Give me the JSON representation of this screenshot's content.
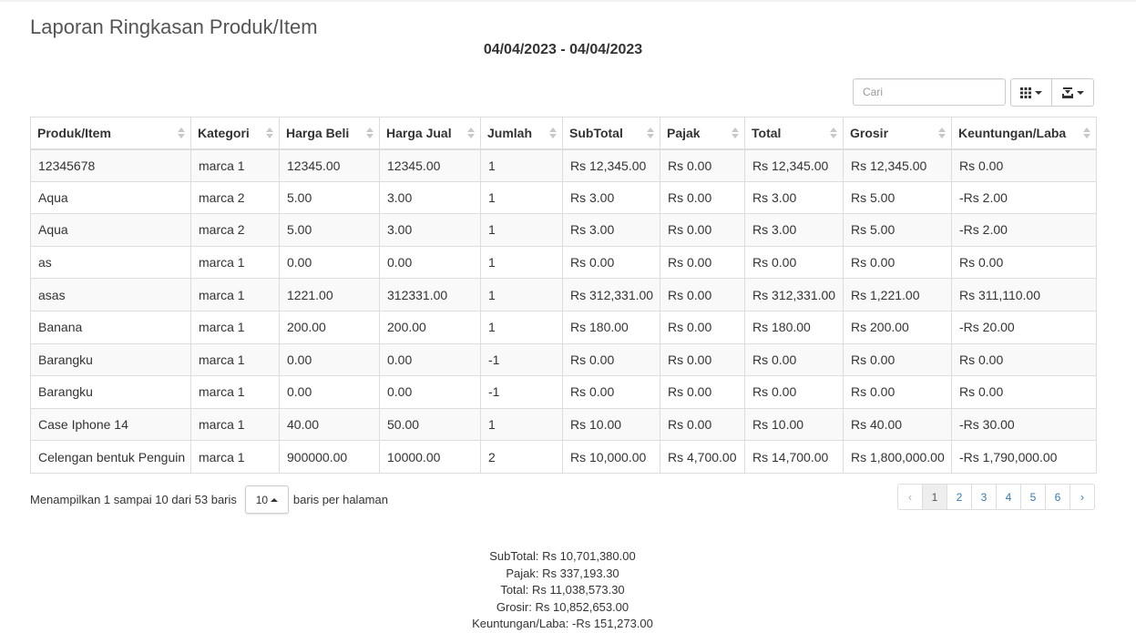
{
  "page": {
    "title": "Laporan Ringkasan Produk/Item",
    "date_range": "04/04/2023 - 04/04/2023"
  },
  "toolbar": {
    "search_placeholder": "Cari",
    "columns_icon": "grid-icon",
    "export_icon": "export-icon"
  },
  "table": {
    "headers": [
      "Produk/Item",
      "Kategori",
      "Harga Beli",
      "Harga Jual",
      "Jumlah",
      "SubTotal",
      "Pajak",
      "Total",
      "Grosir",
      "Keuntungan/Laba"
    ],
    "rows": [
      [
        "12345678",
        "marca 1",
        "12345.00",
        "12345.00",
        "1",
        "Rs 12,345.00",
        "Rs 0.00",
        "Rs 12,345.00",
        "Rs 12,345.00",
        "Rs 0.00"
      ],
      [
        "Aqua",
        "marca 2",
        "5.00",
        "3.00",
        "1",
        "Rs 3.00",
        "Rs 0.00",
        "Rs 3.00",
        "Rs 5.00",
        "-Rs 2.00"
      ],
      [
        "Aqua",
        "marca 2",
        "5.00",
        "3.00",
        "1",
        "Rs 3.00",
        "Rs 0.00",
        "Rs 3.00",
        "Rs 5.00",
        "-Rs 2.00"
      ],
      [
        "as",
        "marca 1",
        "0.00",
        "0.00",
        "1",
        "Rs 0.00",
        "Rs 0.00",
        "Rs 0.00",
        "Rs 0.00",
        "Rs 0.00"
      ],
      [
        "asas",
        "marca 1",
        "1221.00",
        "312331.00",
        "1",
        "Rs 312,331.00",
        "Rs 0.00",
        "Rs 312,331.00",
        "Rs 1,221.00",
        "Rs 311,110.00"
      ],
      [
        "Banana",
        "marca 1",
        "200.00",
        "200.00",
        "1",
        "Rs 180.00",
        "Rs 0.00",
        "Rs 180.00",
        "Rs 200.00",
        "-Rs 20.00"
      ],
      [
        "Barangku",
        "marca 1",
        "0.00",
        "0.00",
        "-1",
        "Rs 0.00",
        "Rs 0.00",
        "Rs 0.00",
        "Rs 0.00",
        "Rs 0.00"
      ],
      [
        "Barangku",
        "marca 1",
        "0.00",
        "0.00",
        "-1",
        "Rs 0.00",
        "Rs 0.00",
        "Rs 0.00",
        "Rs 0.00",
        "Rs 0.00"
      ],
      [
        "Case Iphone 14",
        "marca 1",
        "40.00",
        "50.00",
        "1",
        "Rs 10.00",
        "Rs 0.00",
        "Rs 10.00",
        "Rs 40.00",
        "-Rs 30.00"
      ],
      [
        "Celengan bentuk Penguin",
        "marca 1",
        "900000.00",
        "10000.00",
        "2",
        "Rs 10,000.00",
        "Rs 4,700.00",
        "Rs 14,700.00",
        "Rs 1,800,000.00",
        "-Rs 1,790,000.00"
      ]
    ]
  },
  "pagination": {
    "info_text": "Menampilkan 1 sampai 10 dari 53 baris",
    "page_size": "10",
    "per_page_text": "baris per halaman",
    "prev": "‹",
    "next": "›",
    "pages": [
      "1",
      "2",
      "3",
      "4",
      "5",
      "6"
    ],
    "active_page": "1"
  },
  "summary": {
    "subtotal": "SubTotal: Rs 10,701,380.00",
    "pajak": "Pajak: Rs 337,193.30",
    "total": "Total: Rs 11,038,573.30",
    "grosir": "Grosir: Rs 10,852,653.00",
    "laba": "Keuntungan/Laba: -Rs 151,273.00"
  }
}
